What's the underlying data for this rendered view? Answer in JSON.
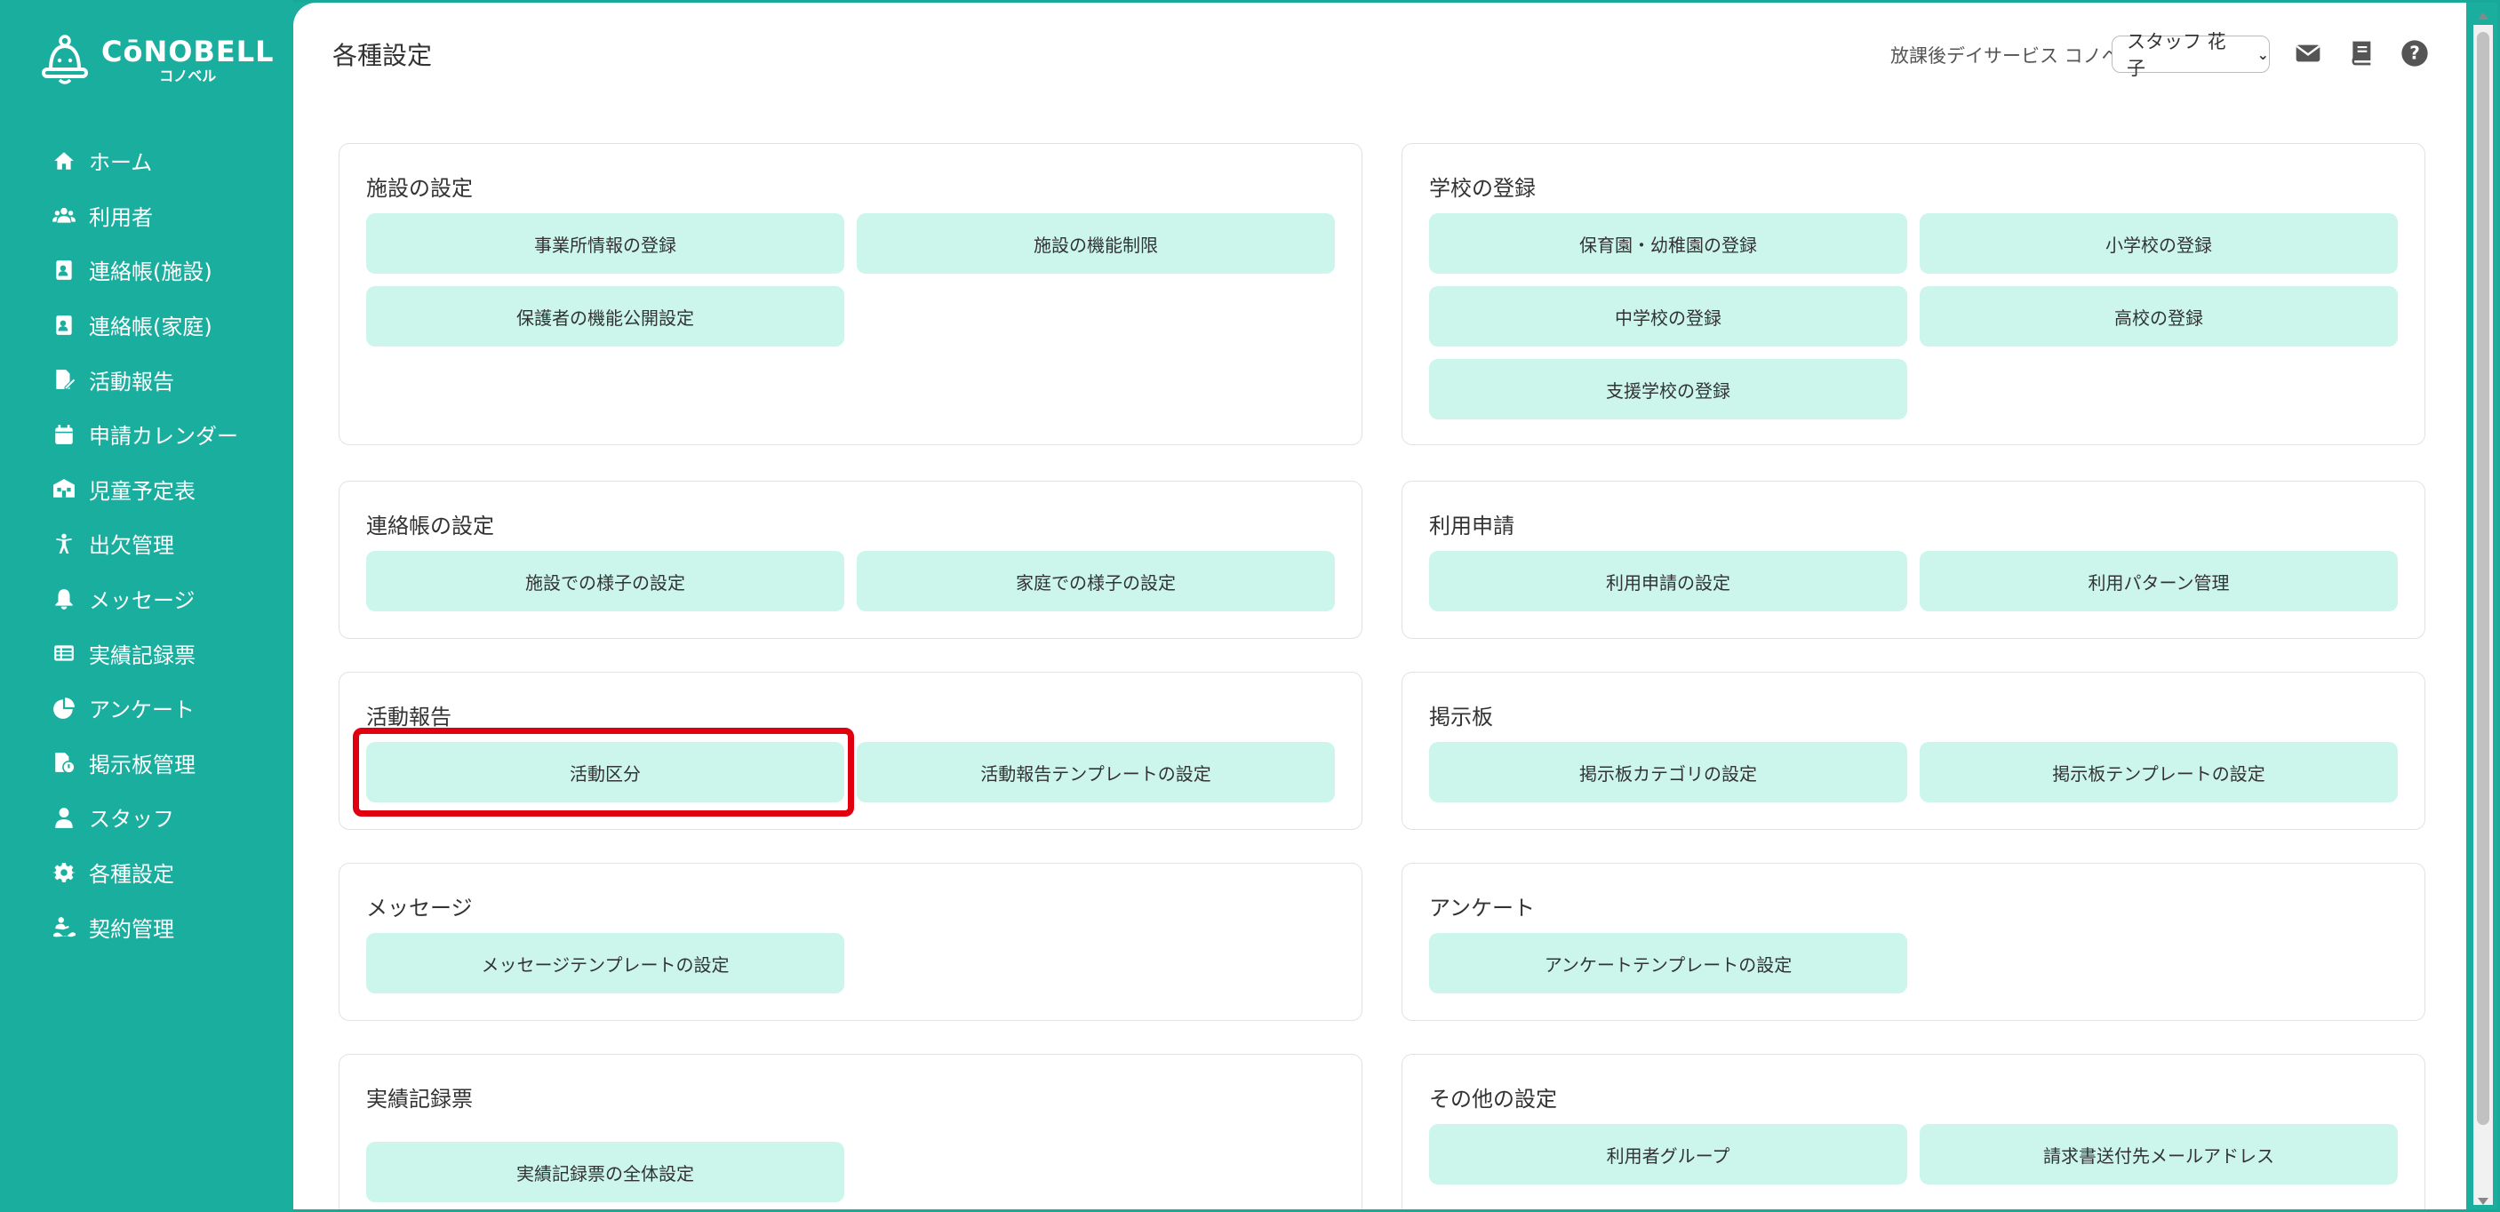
{
  "brand": {
    "name": "CōNOBELL",
    "sub": "コノベル"
  },
  "sidebar": {
    "items": [
      {
        "label": "ホーム",
        "icon": "home-icon"
      },
      {
        "label": "利用者",
        "icon": "users-icon"
      },
      {
        "label": "連絡帳(施設)",
        "icon": "contact-book-icon"
      },
      {
        "label": "連絡帳(家庭)",
        "icon": "contact-book-icon"
      },
      {
        "label": "活動報告",
        "icon": "report-icon"
      },
      {
        "label": "申請カレンダー",
        "icon": "calendar-icon"
      },
      {
        "label": "児童予定表",
        "icon": "schedule-icon"
      },
      {
        "label": "出欠管理",
        "icon": "attendance-icon"
      },
      {
        "label": "メッセージ",
        "icon": "bell-icon"
      },
      {
        "label": "実績記録票",
        "icon": "table-icon"
      },
      {
        "label": "アンケート",
        "icon": "pie-chart-icon"
      },
      {
        "label": "掲示板管理",
        "icon": "board-icon"
      },
      {
        "label": "スタッフ",
        "icon": "staff-icon"
      },
      {
        "label": "各種設定",
        "icon": "gear-icon"
      },
      {
        "label": "契約管理",
        "icon": "contract-icon"
      }
    ]
  },
  "header": {
    "title": "各種設定",
    "facility": "放課後デイサービス コノベル",
    "user": "スタッフ 花子"
  },
  "cards": {
    "facility": {
      "title": "施設の設定",
      "buttons": [
        "事業所情報の登録",
        "施設の機能制限",
        "保護者の機能公開設定"
      ]
    },
    "school": {
      "title": "学校の登録",
      "buttons": [
        "保育園・幼稚園の登録",
        "小学校の登録",
        "中学校の登録",
        "高校の登録",
        "支援学校の登録"
      ]
    },
    "contact": {
      "title": "連絡帳の設定",
      "buttons": [
        "施設での様子の設定",
        "家庭での様子の設定"
      ]
    },
    "usage": {
      "title": "利用申請",
      "buttons": [
        "利用申請の設定",
        "利用パターン管理"
      ]
    },
    "activity": {
      "title": "活動報告",
      "buttons": [
        "活動区分",
        "活動報告テンプレートの設定"
      ]
    },
    "board": {
      "title": "掲示板",
      "buttons": [
        "掲示板カテゴリの設定",
        "掲示板テンプレートの設定"
      ]
    },
    "message": {
      "title": "メッセージ",
      "buttons": [
        "メッセージテンプレートの設定"
      ]
    },
    "survey": {
      "title": "アンケート",
      "buttons": [
        "アンケートテンプレートの設定"
      ]
    },
    "record": {
      "title": "実績記録票",
      "buttons": [
        "実績記録票の全体設定"
      ]
    },
    "other": {
      "title": "その他の設定",
      "buttons": [
        "利用者グループ",
        "請求書送付先メールアドレス"
      ]
    }
  },
  "colors": {
    "accent": "#1aae9f",
    "button_bg": "#ccf6ec",
    "highlight": "#e0000f"
  }
}
